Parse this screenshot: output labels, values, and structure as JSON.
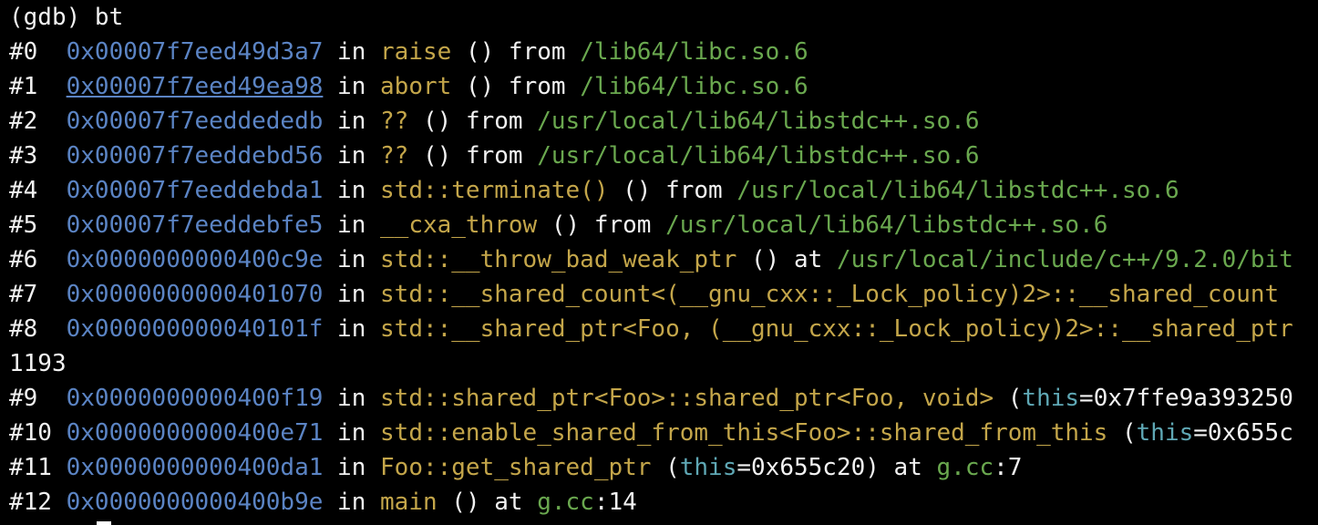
{
  "terminal": {
    "lines": [
      [
        {
          "t": "(gdb) bt",
          "c": "txt"
        }
      ],
      [
        {
          "t": "#0  ",
          "c": "txt"
        },
        {
          "t": "0x00007f7eed49d3a7",
          "c": "addr"
        },
        {
          "t": " in ",
          "c": "txt"
        },
        {
          "t": "raise",
          "c": "func"
        },
        {
          "t": " () from ",
          "c": "txt"
        },
        {
          "t": "/lib64/libc.so.6",
          "c": "path"
        }
      ],
      [
        {
          "t": "#1  ",
          "c": "txt"
        },
        {
          "t": "0x00007f7eed49ea98",
          "c": "addr",
          "link": true
        },
        {
          "t": " in ",
          "c": "txt"
        },
        {
          "t": "abort",
          "c": "func"
        },
        {
          "t": " () from ",
          "c": "txt"
        },
        {
          "t": "/lib64/libc.so.6",
          "c": "path"
        }
      ],
      [
        {
          "t": "#2  ",
          "c": "txt"
        },
        {
          "t": "0x00007f7eeddededb",
          "c": "addr"
        },
        {
          "t": " in ",
          "c": "txt"
        },
        {
          "t": "??",
          "c": "func"
        },
        {
          "t": " () from ",
          "c": "txt"
        },
        {
          "t": "/usr/local/lib64/libstdc++.so.6",
          "c": "path"
        }
      ],
      [
        {
          "t": "#3  ",
          "c": "txt"
        },
        {
          "t": "0x00007f7eeddebd56",
          "c": "addr"
        },
        {
          "t": " in ",
          "c": "txt"
        },
        {
          "t": "??",
          "c": "func"
        },
        {
          "t": " () from ",
          "c": "txt"
        },
        {
          "t": "/usr/local/lib64/libstdc++.so.6",
          "c": "path"
        }
      ],
      [
        {
          "t": "#4  ",
          "c": "txt"
        },
        {
          "t": "0x00007f7eeddebda1",
          "c": "addr"
        },
        {
          "t": " in ",
          "c": "txt"
        },
        {
          "t": "std::terminate()",
          "c": "func"
        },
        {
          "t": " () from ",
          "c": "txt"
        },
        {
          "t": "/usr/local/lib64/libstdc++.so.6",
          "c": "path"
        }
      ],
      [
        {
          "t": "#5  ",
          "c": "txt"
        },
        {
          "t": "0x00007f7eeddebfe5",
          "c": "addr"
        },
        {
          "t": " in ",
          "c": "txt"
        },
        {
          "t": "__cxa_throw",
          "c": "func"
        },
        {
          "t": " () from ",
          "c": "txt"
        },
        {
          "t": "/usr/local/lib64/libstdc++.so.6",
          "c": "path"
        }
      ],
      [
        {
          "t": "#6  ",
          "c": "txt"
        },
        {
          "t": "0x0000000000400c9e",
          "c": "addr"
        },
        {
          "t": " in ",
          "c": "txt"
        },
        {
          "t": "std::__throw_bad_weak_ptr",
          "c": "func"
        },
        {
          "t": " () at ",
          "c": "txt"
        },
        {
          "t": "/usr/local/include/c++/9.2.0/bit",
          "c": "path"
        }
      ],
      [
        {
          "t": "#7  ",
          "c": "txt"
        },
        {
          "t": "0x0000000000401070",
          "c": "addr"
        },
        {
          "t": " in ",
          "c": "txt"
        },
        {
          "t": "std::__shared_count<(__gnu_cxx::_Lock_policy)2>::__shared_count",
          "c": "func"
        }
      ],
      [
        {
          "t": "#8  ",
          "c": "txt"
        },
        {
          "t": "0x000000000040101f",
          "c": "addr"
        },
        {
          "t": " in ",
          "c": "txt"
        },
        {
          "t": "std::__shared_ptr<Foo, (__gnu_cxx::_Lock_policy)2>::__shared_ptr",
          "c": "func"
        }
      ],
      [
        {
          "t": "1193",
          "c": "txt"
        }
      ],
      [
        {
          "t": "#9  ",
          "c": "txt"
        },
        {
          "t": "0x0000000000400f19",
          "c": "addr"
        },
        {
          "t": " in ",
          "c": "txt"
        },
        {
          "t": "std::shared_ptr<Foo>::shared_ptr<Foo, void>",
          "c": "func"
        },
        {
          "t": " (",
          "c": "txt"
        },
        {
          "t": "this",
          "c": "kw"
        },
        {
          "t": "=0x7ffe9a393250",
          "c": "txt"
        }
      ],
      [
        {
          "t": "#10 ",
          "c": "txt"
        },
        {
          "t": "0x0000000000400e71",
          "c": "addr"
        },
        {
          "t": " in ",
          "c": "txt"
        },
        {
          "t": "std::enable_shared_from_this<Foo>::shared_from_this",
          "c": "func"
        },
        {
          "t": " (",
          "c": "txt"
        },
        {
          "t": "this",
          "c": "kw"
        },
        {
          "t": "=0x655c",
          "c": "txt"
        }
      ],
      [
        {
          "t": "#11 ",
          "c": "txt"
        },
        {
          "t": "0x0000000000400da1",
          "c": "addr"
        },
        {
          "t": " in ",
          "c": "txt"
        },
        {
          "t": "Foo::get_shared_ptr",
          "c": "func"
        },
        {
          "t": " (",
          "c": "txt"
        },
        {
          "t": "this",
          "c": "kw"
        },
        {
          "t": "=0x655c20) at ",
          "c": "txt"
        },
        {
          "t": "g.cc",
          "c": "path"
        },
        {
          "t": ":7",
          "c": "txt"
        }
      ],
      [
        {
          "t": "#12 ",
          "c": "txt"
        },
        {
          "t": "0x0000000000400b9e",
          "c": "addr"
        },
        {
          "t": " in ",
          "c": "txt"
        },
        {
          "t": "main",
          "c": "func"
        },
        {
          "t": " () at ",
          "c": "txt"
        },
        {
          "t": "g.cc",
          "c": "path"
        },
        {
          "t": ":14",
          "c": "txt"
        }
      ]
    ]
  },
  "colors": {
    "background": "#000000",
    "text": "#f2f2f2",
    "address": "#5b84c4",
    "function": "#c4a64a",
    "path": "#6aa84f",
    "keyword": "#5fa8b5"
  }
}
